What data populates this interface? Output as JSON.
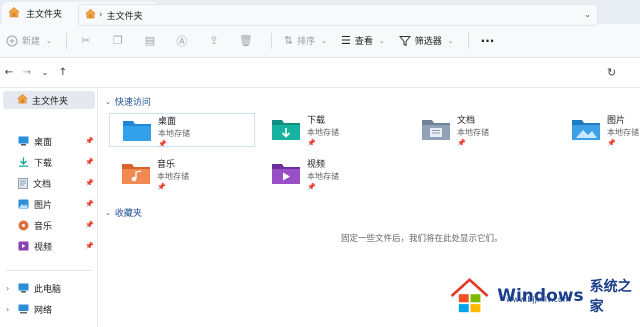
{
  "tab": {
    "title": "主文件夹",
    "close": "×",
    "new_tab": "+"
  },
  "toolbar": {
    "new_label": "新建",
    "sort_label": "排序",
    "view_label": "查看",
    "filter_label": "筛选器",
    "more": "···"
  },
  "address": {
    "crumb": "主文件夹",
    "separator": "›"
  },
  "sidebar": {
    "home": "主文件夹",
    "pinned": [
      {
        "label": "桌面",
        "icon": "desktop-icon",
        "color": "#2b8fd8"
      },
      {
        "label": "下载",
        "icon": "download-icon",
        "color": "#14a39a"
      },
      {
        "label": "文档",
        "icon": "document-icon",
        "color": "#7b8b9d"
      },
      {
        "label": "图片",
        "icon": "picture-icon",
        "color": "#2b8fd8"
      },
      {
        "label": "音乐",
        "icon": "music-icon",
        "color": "#e0703a"
      },
      {
        "label": "视频",
        "icon": "video-icon",
        "color": "#8a3fb3"
      }
    ],
    "drives": [
      {
        "label": "此电脑",
        "icon": "pc-icon"
      },
      {
        "label": "网络",
        "icon": "network-icon"
      }
    ]
  },
  "main": {
    "quick_access": "快速访问",
    "favorites": "收藏夹",
    "empty_text": "固定一些文件后，我们将在此处显示它们。",
    "folders": [
      {
        "name": "桌面",
        "sub": "本地存储",
        "color": "#1f86d6",
        "icon": "desktop-folder-icon"
      },
      {
        "name": "下载",
        "sub": "本地存储",
        "color": "#12a08f",
        "icon": "download-folder-icon"
      },
      {
        "name": "文档",
        "sub": "本地存储",
        "color": "#7c8ea3",
        "icon": "documents-folder-icon"
      },
      {
        "name": "图片",
        "sub": "本地存储",
        "color": "#2a8fd7",
        "icon": "pictures-folder-icon"
      },
      {
        "name": "音乐",
        "sub": "本地存储",
        "color": "#e8733c",
        "icon": "music-folder-icon"
      },
      {
        "name": "视频",
        "sub": "本地存储",
        "color": "#8b41b5",
        "icon": "videos-folder-icon"
      }
    ]
  },
  "watermark": {
    "brand": "Windows",
    "site": "系统之家",
    "url": "www.bjjmlv.com"
  }
}
